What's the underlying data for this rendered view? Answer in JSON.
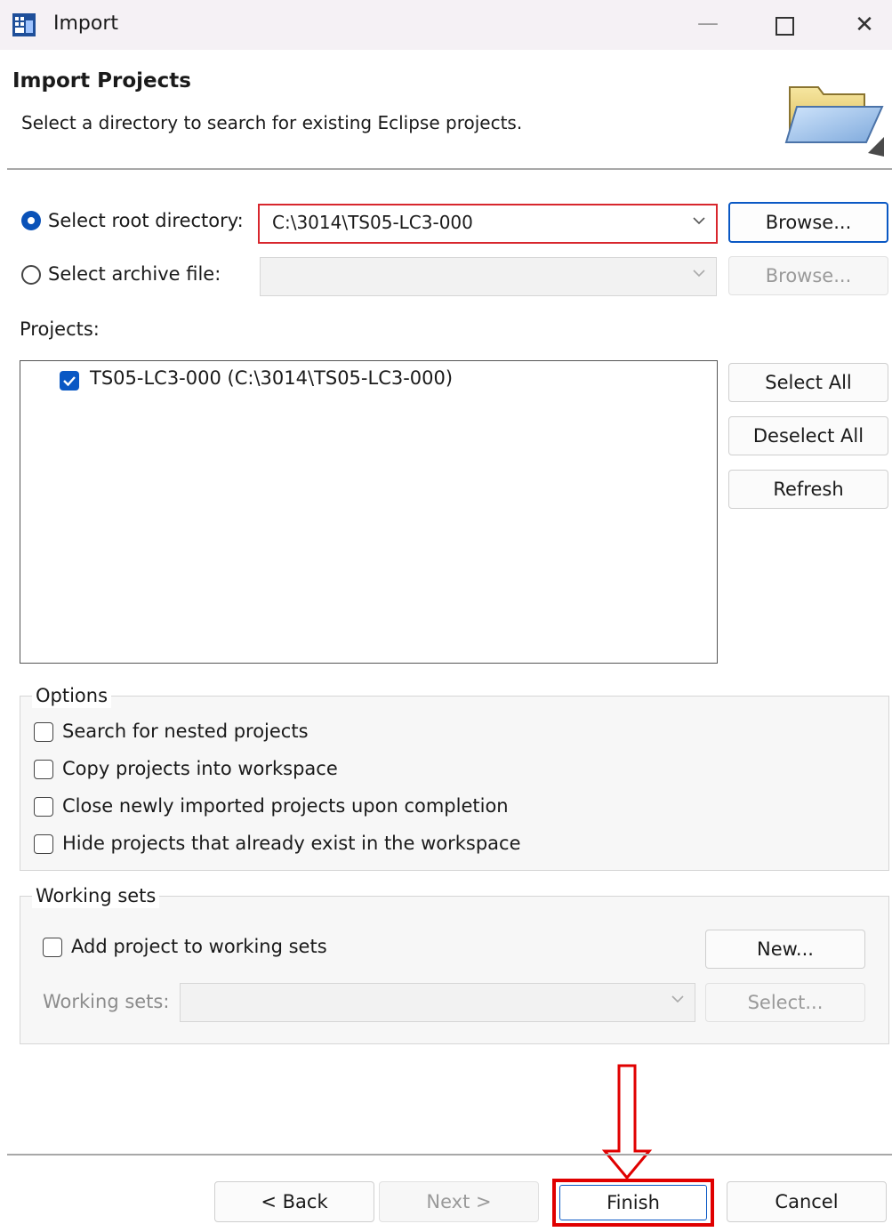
{
  "window": {
    "title": "Import",
    "minimize_glyph": "—",
    "close_glyph": "✕"
  },
  "banner": {
    "heading": "Import Projects",
    "description": "Select a directory to search for existing Eclipse projects."
  },
  "source": {
    "root_directory_label": "Select root directory:",
    "root_directory_value": "C:\\3014\\TS05-LC3-000",
    "root_selected": true,
    "archive_label": "Select archive file:",
    "archive_value": "",
    "browse_label": "Browse..."
  },
  "projects": {
    "label": "Projects:",
    "items": [
      {
        "label": "TS05-LC3-000 (C:\\3014\\TS05-LC3-000)",
        "checked": true
      }
    ],
    "select_all_label": "Select All",
    "deselect_all_label": "Deselect All",
    "refresh_label": "Refresh"
  },
  "options": {
    "title": "Options",
    "items": [
      {
        "label": "Search for nested projects",
        "checked": false
      },
      {
        "label": "Copy projects into workspace",
        "checked": false
      },
      {
        "label": "Close newly imported projects upon completion",
        "checked": false
      },
      {
        "label": "Hide projects that already exist in the workspace",
        "checked": false
      }
    ]
  },
  "working_sets": {
    "title": "Working sets",
    "add_label": "Add project to working sets",
    "add_checked": false,
    "new_label": "New...",
    "sets_label": "Working sets:",
    "sets_value": "",
    "select_label": "Select..."
  },
  "footer": {
    "back_label": "< Back",
    "next_label": "Next >",
    "finish_label": "Finish",
    "cancel_label": "Cancel"
  },
  "colors": {
    "accent": "#0a58c4",
    "highlight_red": "#e00000",
    "titlebar_bg": "#f5f1f5"
  }
}
